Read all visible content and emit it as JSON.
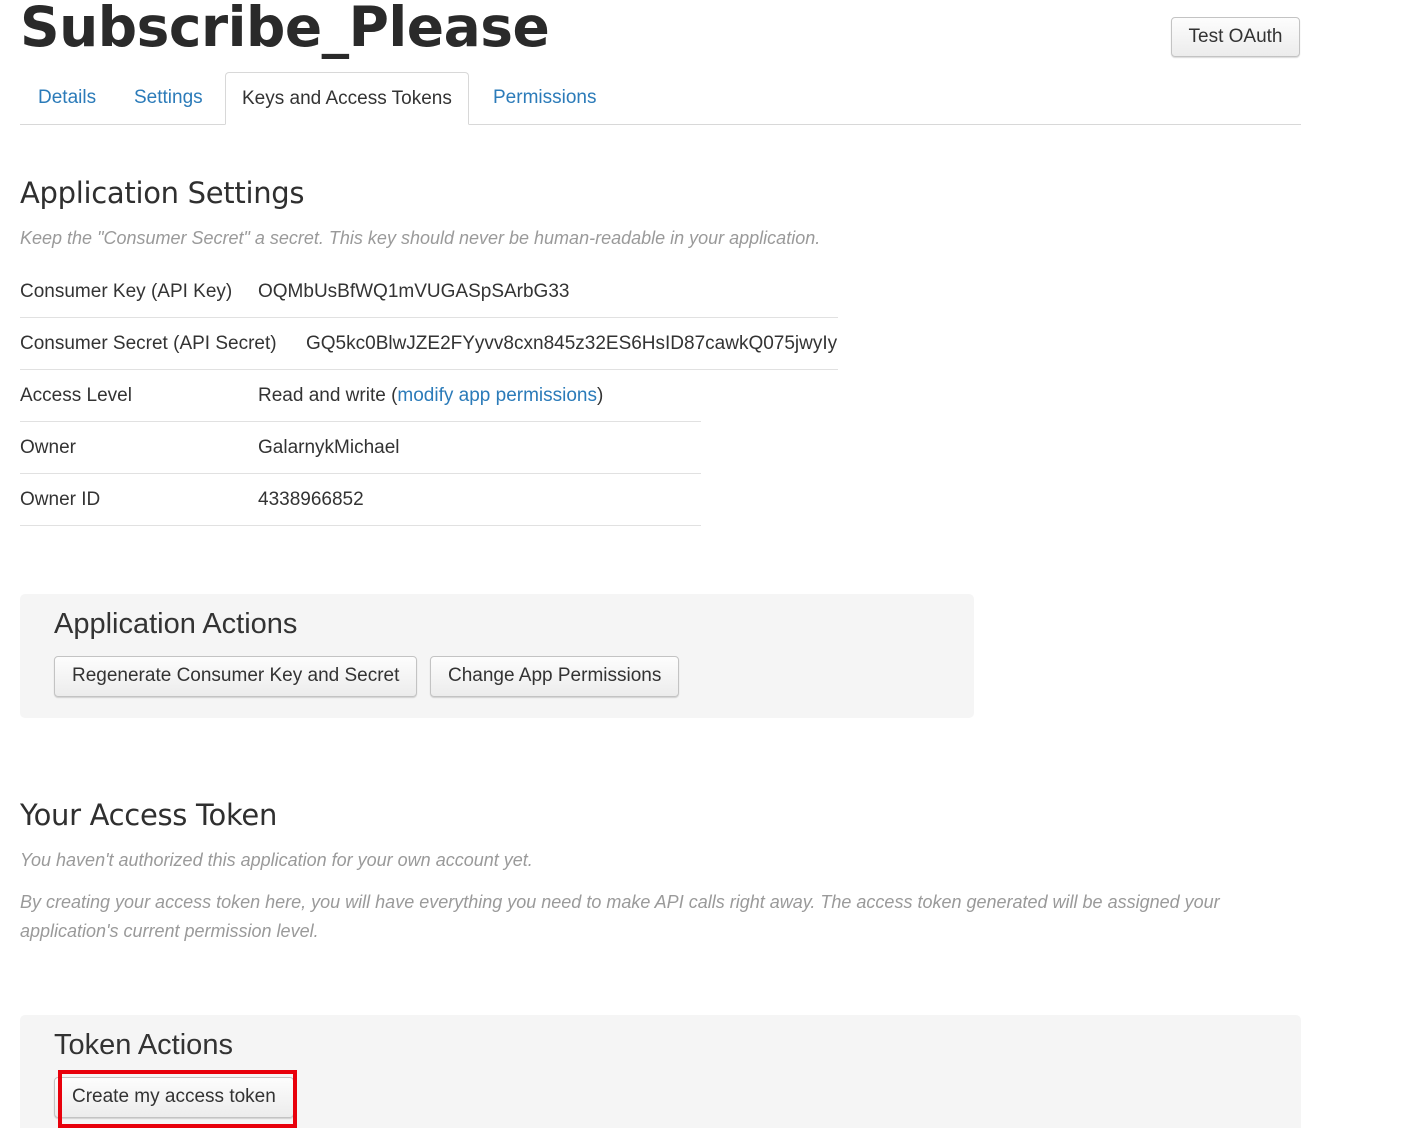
{
  "app": {
    "title": "Subscribe_Please",
    "test_oauth_label": "Test OAuth"
  },
  "tabs": [
    {
      "label": "Details",
      "active": false
    },
    {
      "label": "Settings",
      "active": false
    },
    {
      "label": "Keys and Access Tokens",
      "active": true
    },
    {
      "label": "Permissions",
      "active": false
    }
  ],
  "application_settings": {
    "heading": "Application Settings",
    "note": "Keep the \"Consumer Secret\" a secret. This key should never be human-readable in your application.",
    "rows": [
      {
        "key": "Consumer Key (API Key)",
        "value": "OQMbUsBfWQ1mVUGASpSArbG33"
      },
      {
        "key": "Consumer Secret (API Secret)",
        "value": "GQ5kc0BlwJZE2FYyvv8cxn845z32ES6HsID87cawkQ075jwyIy"
      },
      {
        "key": "Access Level",
        "value_prefix": "Read and write (",
        "link_text": "modify app permissions",
        "value_suffix": ")"
      },
      {
        "key": "Owner",
        "value": "GalarnykMichael"
      },
      {
        "key": "Owner ID",
        "value": "4338966852"
      }
    ]
  },
  "application_actions": {
    "heading": "Application Actions",
    "regenerate_label": "Regenerate Consumer Key and Secret",
    "change_permissions_label": "Change App Permissions"
  },
  "access_token": {
    "heading": "Your Access Token",
    "note1": "You haven't authorized this application for your own account yet.",
    "note2": "By creating your access token here, you will have everything you need to make API calls right away. The access token generated will be assigned your application's current permission level."
  },
  "token_actions": {
    "heading": "Token Actions",
    "create_label": "Create my access token"
  },
  "colors": {
    "link": "#2b7bb9",
    "highlight": "#e8000b",
    "action_box_bg": "#f5f5f5"
  }
}
